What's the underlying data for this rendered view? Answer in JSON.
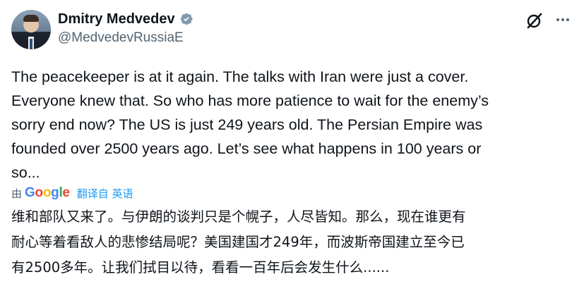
{
  "author": {
    "display_name": "Dmitry Medvedev",
    "handle": "@MedvedevRussiaE",
    "verified": true
  },
  "icons": {
    "verified": "verified-badge-icon",
    "grok": "grok-icon",
    "more": "more-icon"
  },
  "colors": {
    "text_primary": "#0f1419",
    "text_secondary": "#536471",
    "link": "#1d9bf0"
  },
  "tweet": {
    "lines": [
      "The peacekeeper is at it again. The talks with Iran were just a cover.",
      "Everyone knew that. So who has more patience to wait for the enemy’s",
      "sorry end now? The US is just 249 years old. The Persian Empire was",
      "founded over 2500 years ago. Let’s see what happens in 100 years or",
      "so..."
    ]
  },
  "translation": {
    "by_label": "由",
    "provider": {
      "letters": [
        "G",
        "o",
        "o",
        "g",
        "l",
        "e"
      ]
    },
    "link_label": "翻译自 英语",
    "lines": [
      "维和部队又来了。与伊朗的谈判只是个幌子，人尽皆知。那么，现在谁更有",
      "耐心等着看敌人的悲惨结局呢？美国建国才249年，而波斯帝国建立至今已",
      "有2500多年。让我们拭目以待，看看一百年后会发生什么......"
    ]
  }
}
